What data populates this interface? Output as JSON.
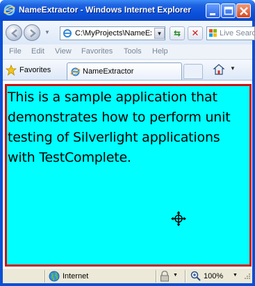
{
  "window": {
    "title": "NameExtractor - Windows Internet Explorer"
  },
  "address_bar": {
    "url": "C:\\MyProjects\\NameExtractor\\",
    "search_placeholder": "Live Search"
  },
  "menu": {
    "items": [
      "File",
      "Edit",
      "View",
      "Favorites",
      "Tools",
      "Help"
    ]
  },
  "favorites_bar": {
    "favorites_label": "Favorites",
    "tab_title": "NameExtractor"
  },
  "content": {
    "text": "This is a sample application that demonstrates how to perform unit testing of Silverlight applications with TestComplete.",
    "background_color": "#00ffff",
    "border_color": "#d01010"
  },
  "status_bar": {
    "zone": "Internet",
    "zoom": "100%"
  },
  "icons": {
    "title": "ie-logo-icon",
    "back": "back-arrow-icon",
    "forward": "forward-arrow-icon",
    "refresh": "refresh-icon",
    "stop": "stop-icon",
    "favorites": "favorites-star-icon",
    "home": "home-icon",
    "zone": "globe-icon",
    "zoom": "magnifier-icon",
    "cursor": "move-cursor-icon"
  }
}
